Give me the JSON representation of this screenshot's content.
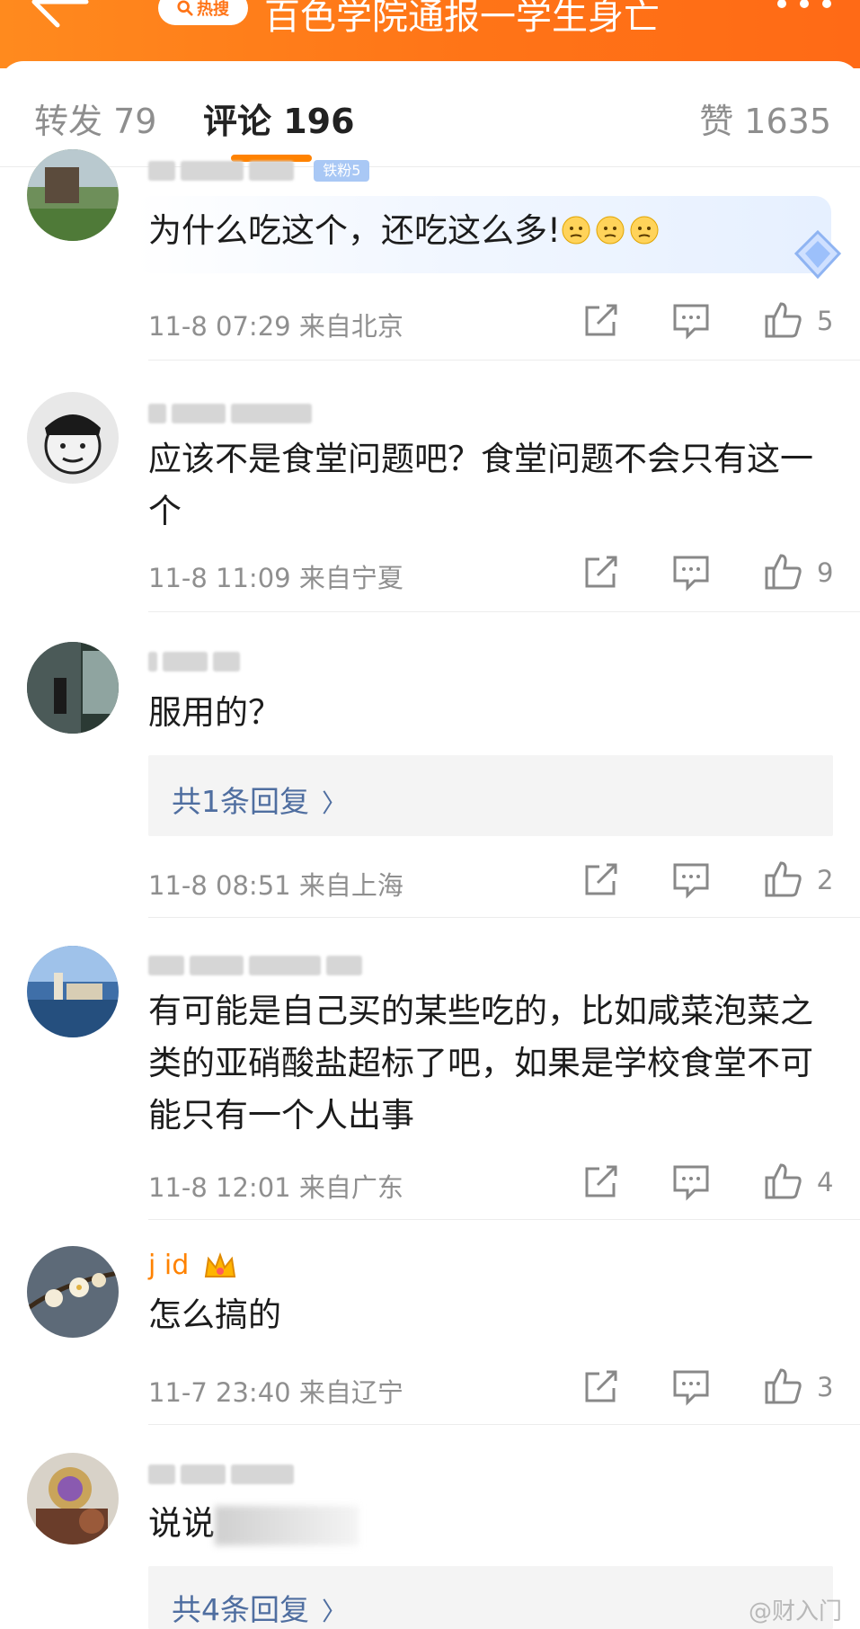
{
  "header": {
    "hot_chip_label": "热搜",
    "title": "百色学院通报一学生身亡"
  },
  "tabs": {
    "repost_label": "转发 79",
    "comments_label": "评论 196",
    "likes_label": "赞 1635"
  },
  "colors": {
    "header_orange": "#ff7417",
    "tab_underline": "#ff8200",
    "reply_link": "#4f6ea0"
  },
  "comments": [
    {
      "text": "为什么吃这个，还吃这么多!",
      "emoji": [
        "thinking-face-icon",
        "thinking-face-icon",
        "thinking-face-icon"
      ],
      "badge": "铁粉5",
      "time": "11-8 07:29",
      "location": "来自北京",
      "likes": "5"
    },
    {
      "text": "应该不是食堂问题吧？食堂问题不会只有这一个",
      "time": "11-8 11:09",
      "location": "来自宁夏",
      "likes": "9"
    },
    {
      "text": "服用的？",
      "reply_link": "共1条回复",
      "time": "11-8 08:51",
      "location": "来自上海",
      "likes": "2"
    },
    {
      "text": "有可能是自己买的某些吃的，比如咸菜泡菜之类的亚硝酸盐超标了吧，如果是学校食堂不可能只有一个人出事",
      "time": "11-8 12:01",
      "location": "来自广东",
      "likes": "4"
    },
    {
      "text": "怎么搞的",
      "username_visible": "j  id",
      "time": "11-7 23:40",
      "location": "来自辽宁",
      "likes": "3"
    },
    {
      "text": "说说",
      "reply_link": "共4条回复"
    }
  ],
  "watermark": "@财入门"
}
